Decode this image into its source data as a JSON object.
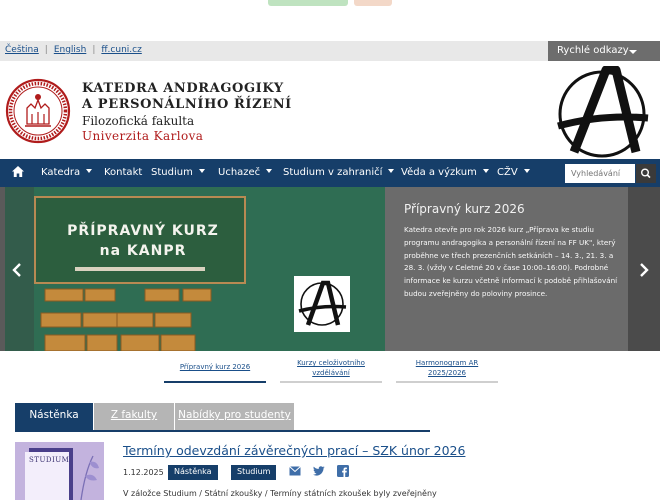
{
  "topbar": {
    "languages": [
      "Čeština",
      "English",
      "ff.cuni.cz"
    ],
    "quick_links_label": "Rychlé odkazy"
  },
  "header": {
    "title_line1": "KATEDRA ANDRAGOGIKY",
    "title_line2": "A PERSONÁLNÍHO ŘÍZENÍ",
    "faculty": "Filozofická fakulta",
    "university": "Univerzita Karlova"
  },
  "nav": {
    "items": [
      "Katedra",
      "Kontakt",
      "Studium",
      "Uchazeč",
      "Studium v zahraničí",
      "Věda a výzkum",
      "CŽV"
    ],
    "search_placeholder": "Vyhledávání"
  },
  "slider": {
    "image_board_line1": "PŘÍPRAVNÝ KURZ",
    "image_board_line2": "na KANPR",
    "heading": "Přípravný kurz 2026",
    "text": "Katedra otevře pro rok 2026 kurz „Příprava ke studiu programu andragogika a personální řízení na FF UK\", který proběhne ve třech prezenčních setkáních – 14. 3., 21. 3. a 28. 3. (vždy v Celetné 20 v čase 10:00–16:00). Podrobné informace ke kurzu včetně informací k podobě přihlašování budou zveřejněny do poloviny prosince."
  },
  "slide_tabs": [
    {
      "label": "Přípravný kurz 2026",
      "active": true
    },
    {
      "label": "Kurzy celoživotního vzdělávání",
      "active": false
    },
    {
      "label": "Harmonogram AR 2025/2026",
      "active": false
    }
  ],
  "news_tabs": [
    "Nástěnka",
    "Z fakulty",
    "Nabídky pro studenty"
  ],
  "news": {
    "thumb_label": "STUDIUM",
    "title": "Termíny odevzdání závěrečných prací – SZK únor 2026",
    "date": "1.12.2025",
    "tags": [
      "Nástěnka",
      "Studium"
    ],
    "excerpt": "V záložce Studium / Státní zkoušky / Termíny státních zkoušek byly zveřejněny"
  },
  "colors": {
    "nav": "#163e69",
    "accent_red": "#b01c1c",
    "link": "#1a4f8a"
  }
}
